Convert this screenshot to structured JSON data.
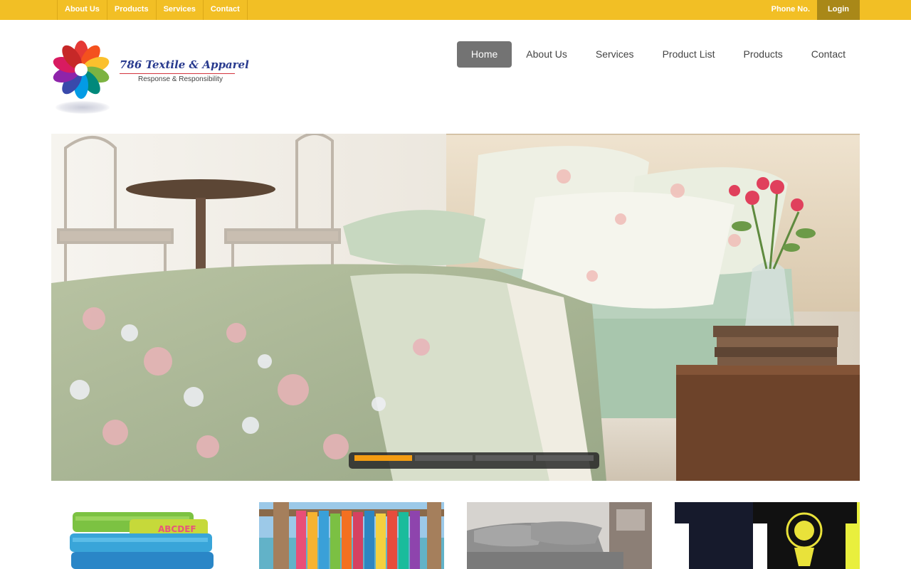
{
  "topbar": {
    "links": [
      "About Us",
      "Products",
      "Services",
      "Contact"
    ],
    "phone_label": "Phone No.",
    "login_label": "Login"
  },
  "logo": {
    "name": "786 Textile & Apparel",
    "tagline": "Response & Responsibility"
  },
  "nav": {
    "items": [
      "Home",
      "About Us",
      "Services",
      "Product List",
      "Products",
      "Contact"
    ],
    "active": "Home"
  },
  "slider": {
    "slide_count": 4,
    "active_slide": 1
  },
  "products": {
    "thumbnails": [
      "towels-photo",
      "beach-towels-photo",
      "grey-bedding-photo",
      "tshirts-photo"
    ]
  },
  "colors": {
    "topbar": "#f2bf25",
    "login_bg": "#a98818",
    "nav_active": "#737373",
    "pager_active": "#f39c12"
  }
}
